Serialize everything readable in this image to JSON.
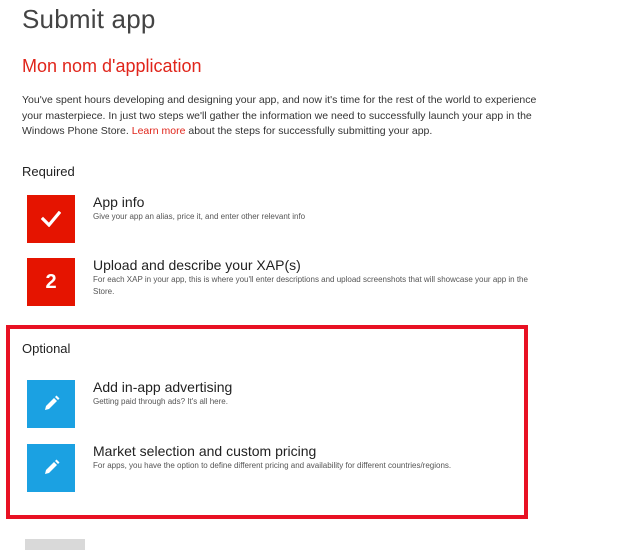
{
  "page": {
    "title": "Submit app",
    "app_name": "Mon nom d'application"
  },
  "intro": {
    "text_before_link": "You've spent hours developing and designing your app, and now it's time for the rest of the world to experience your masterpiece. In just two steps we'll gather the information we need to successfully launch your app in the Windows Phone Store. ",
    "link_text": "Learn more",
    "text_after_link": " about the steps for successfully submitting your app."
  },
  "required": {
    "heading": "Required",
    "steps": [
      {
        "title": "App info",
        "description": "Give your app an alias, price it, and enter other relevant info",
        "status": "complete",
        "icon": "checkmark-icon"
      },
      {
        "title": "Upload and describe your XAP(s)",
        "description": "For each XAP in your app, this is where you'll enter descriptions and upload screenshots that will showcase your app in the Store.",
        "number": "2",
        "icon": "number-tile"
      }
    ]
  },
  "optional": {
    "heading": "Optional",
    "steps": [
      {
        "title": "Add in-app advertising",
        "description": "Getting paid through ads? It's all here.",
        "icon": "pencil-icon"
      },
      {
        "title": "Market selection and custom pricing",
        "description": "For apps, you have the option to define different pricing and availability for different countries/regions.",
        "icon": "pencil-icon"
      }
    ]
  },
  "colors": {
    "accent_red": "#e51400",
    "accent_blue": "#1ba1e2",
    "highlight_border": "#e81123"
  }
}
